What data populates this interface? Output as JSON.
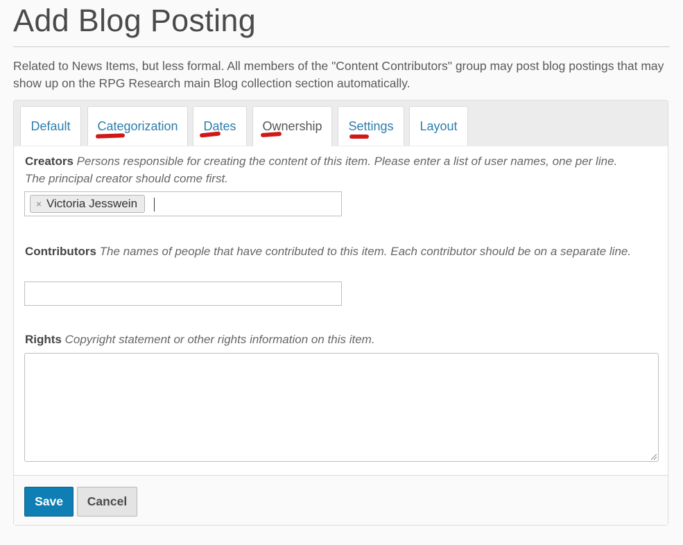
{
  "page": {
    "title": "Add Blog Posting",
    "description": "Related to News Items, but less formal. All members of the \"Content Contributors\" group may post blog postings that may show up on the RPG Research main Blog collection section automatically."
  },
  "tabs": [
    {
      "label": "Default"
    },
    {
      "label": "Categorization"
    },
    {
      "label": "Dates"
    },
    {
      "label": "Ownership",
      "active": true
    },
    {
      "label": "Settings"
    },
    {
      "label": "Layout"
    }
  ],
  "fields": {
    "creators": {
      "label": "Creators",
      "help": "Persons responsible for creating the content of this item. Please enter a list of user names, one per line. The principal creator should come first.",
      "tokens": [
        "Victoria Jesswein"
      ],
      "token_remove_glyph": "×"
    },
    "contributors": {
      "label": "Contributors",
      "help": "The names of people that have contributed to this item. Each contributor should be on a separate line.",
      "value": ""
    },
    "rights": {
      "label": "Rights",
      "help": "Copyright statement or other rights information on this item.",
      "value": ""
    }
  },
  "buttons": {
    "save": "Save",
    "cancel": "Cancel"
  },
  "colors": {
    "link": "#2b7dab",
    "primary_button": "#0f7eb4",
    "annotation_mark": "#d01818"
  }
}
